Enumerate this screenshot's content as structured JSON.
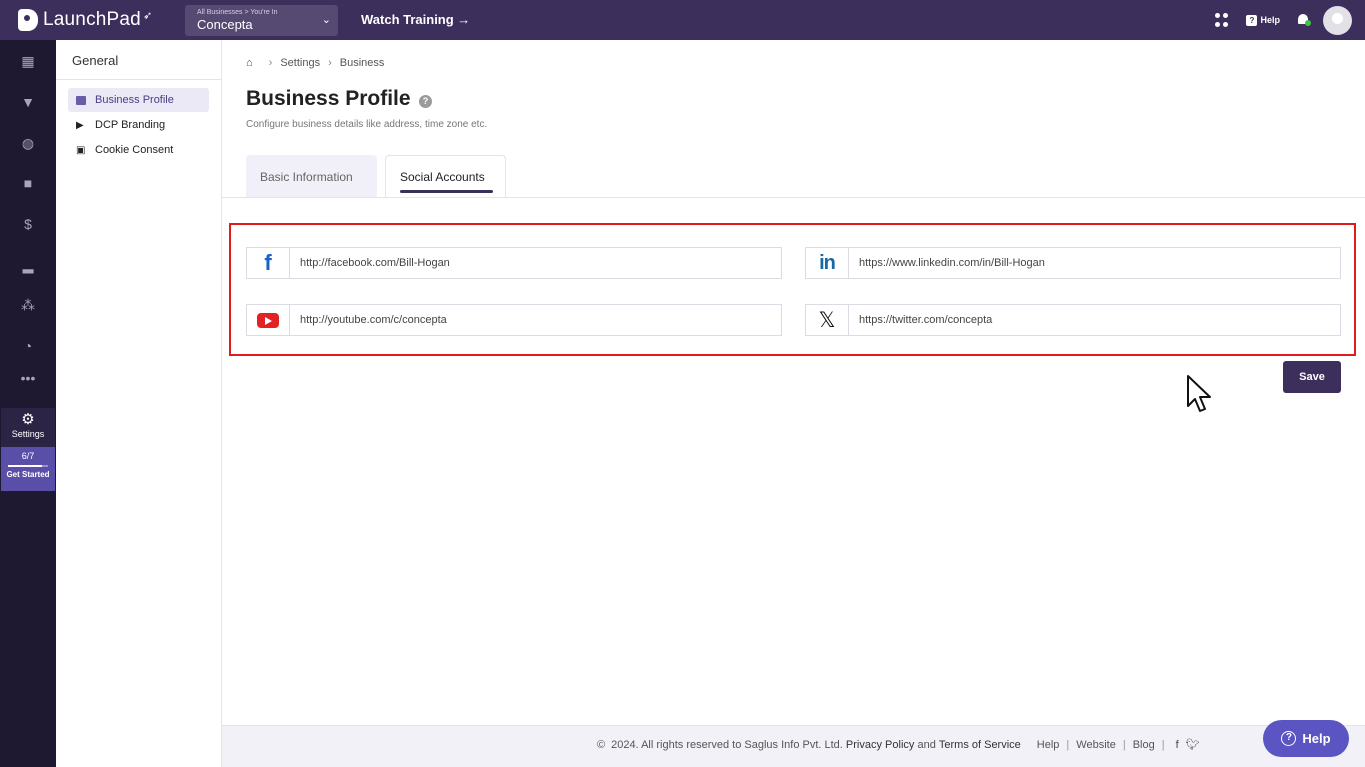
{
  "app": {
    "logo_text": "LaunchPad",
    "business_switch_small": "All Businesses > You're In",
    "business_name": "Concepta",
    "watch_training": "Watch Training →",
    "help_label": "Help"
  },
  "rail": {
    "settings_label": "Settings",
    "progress_text": "6/7",
    "progress_fraction": 0.857,
    "get_started": "Get Started"
  },
  "sidebar": {
    "title": "General",
    "items": [
      {
        "label": "Business Profile",
        "icon": "business-card-icon"
      },
      {
        "label": "DCP Branding",
        "icon": "dcp-logo-icon"
      },
      {
        "label": "Cookie Consent",
        "icon": "cookie-icon"
      }
    ]
  },
  "breadcrumb": [
    "Settings",
    "Business"
  ],
  "page": {
    "title": "Business Profile",
    "subtitle": "Configure business details like address, time zone etc."
  },
  "tabs": [
    "Basic Information",
    "Social Accounts"
  ],
  "social": {
    "facebook": "http://facebook.com/Bill-Hogan",
    "linkedin": "https://www.linkedin.com/in/Bill-Hogan",
    "youtube": "http://youtube.com/c/concepta",
    "twitter": "https://twitter.com/concepta"
  },
  "save_label": "Save",
  "footer": {
    "copyright_symbol": "©",
    "copyright": "2024. All rights reserved to Saglus Info Pvt. Ltd.",
    "privacy": "Privacy Policy",
    "and": "and",
    "terms": "Terms of Service",
    "help": "Help",
    "website": "Website",
    "blog": "Blog"
  },
  "help_float_label": "Help",
  "colors": {
    "topbar": "#3d2f5c",
    "rail": "#1e1830",
    "highlight_border": "#e01b1b",
    "save_button": "#3d2f5c",
    "help_button": "#5a55c2"
  }
}
